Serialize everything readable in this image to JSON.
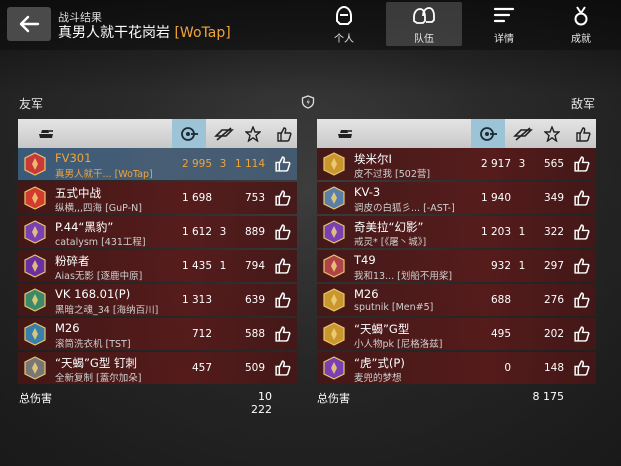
{
  "header": {
    "subtitle": "战斗结果",
    "title": "真男人就干花岗岩",
    "clan_tag": "[WoTap]",
    "tabs": [
      {
        "label": "个人",
        "icon": "helmet-icon",
        "active": false
      },
      {
        "label": "队伍",
        "icon": "team-icon",
        "active": true
      },
      {
        "label": "详情",
        "icon": "details-icon",
        "active": false
      },
      {
        "label": "成就",
        "icon": "medal-icon",
        "active": false
      }
    ]
  },
  "allies": {
    "label": "友军",
    "total_label": "总伤害",
    "total_value": "10 222",
    "players": [
      {
        "tank": "FV301",
        "player": "真男人就干... [WoTap]",
        "damage": "2 995",
        "kills": "3",
        "xp": "1 114",
        "highlight": true,
        "badge_color": "#c83a3a"
      },
      {
        "tank": "五式中战",
        "player": "纵横,,,四海 [GuP-N]",
        "damage": "1 698",
        "kills": "",
        "xp": "753",
        "highlight": false,
        "badge_color": "#d23b2e"
      },
      {
        "tank": "P.44“黑豹”",
        "player": "catalysm [431工程]",
        "damage": "1 612",
        "kills": "3",
        "xp": "889",
        "highlight": false,
        "badge_color": "#7a3fb0"
      },
      {
        "tank": "粉碎者",
        "player": "Aias无影 [逐鹿中原]",
        "damage": "1 435",
        "kills": "1",
        "xp": "794",
        "highlight": false,
        "badge_color": "#6a2fa0"
      },
      {
        "tank": "VK 168.01(P)",
        "player": "黑暗之魂_34 [海纳百川]",
        "damage": "1 313",
        "kills": "",
        "xp": "639",
        "highlight": false,
        "badge_color": "#3c8a6a"
      },
      {
        "tank": "M26",
        "player": "滚筒洗衣机 [TST]",
        "damage": "712",
        "kills": "",
        "xp": "588",
        "highlight": false,
        "badge_color": "#3a7fa8"
      },
      {
        "tank": "“天蝎”G型 钉刺",
        "player": "全新复制 [蓋尔加朵]",
        "damage": "457",
        "kills": "",
        "xp": "509",
        "highlight": false,
        "badge_color": "#777777"
      }
    ]
  },
  "enemies": {
    "label": "敌军",
    "total_label": "总伤害",
    "total_value": "8 175",
    "players": [
      {
        "tank": "埃米尔I",
        "player": "皮不过我 [502营]",
        "damage": "2 917",
        "kills": "3",
        "xp": "565",
        "highlight": false,
        "badge_color": "#c9972e"
      },
      {
        "tank": "KV-3",
        "player": "调皮の白狐彡... [-AST-]",
        "damage": "1 940",
        "kills": "",
        "xp": "349",
        "highlight": false,
        "badge_color": "#5a7fa8"
      },
      {
        "tank": "奇美拉“幻影”",
        "player": "戒灵* [《屠丶城》]",
        "damage": "1 203",
        "kills": "1",
        "xp": "322",
        "highlight": false,
        "badge_color": "#7a3fb0"
      },
      {
        "tank": "T49",
        "player": "我和13... [划船不用桨]",
        "damage": "932",
        "kills": "1",
        "xp": "297",
        "highlight": false,
        "badge_color": "#b0434a"
      },
      {
        "tank": "M26",
        "player": "sputnik [Men#5]",
        "damage": "688",
        "kills": "",
        "xp": "276",
        "highlight": false,
        "badge_color": "#c9972e"
      },
      {
        "tank": "“天蝎”G型",
        "player": "小人物pk [尼格洛兹]",
        "damage": "495",
        "kills": "",
        "xp": "202",
        "highlight": false,
        "badge_color": "#c9972e"
      },
      {
        "tank": "“虎”式(P)",
        "player": "麦兜的梦想",
        "damage": "0",
        "kills": "",
        "xp": "148",
        "highlight": false,
        "badge_color": "#7a3fb0"
      }
    ]
  },
  "columns": [
    "tank-icon",
    "damage-icon",
    "kills-icon",
    "xp-star-icon",
    "like-icon"
  ]
}
